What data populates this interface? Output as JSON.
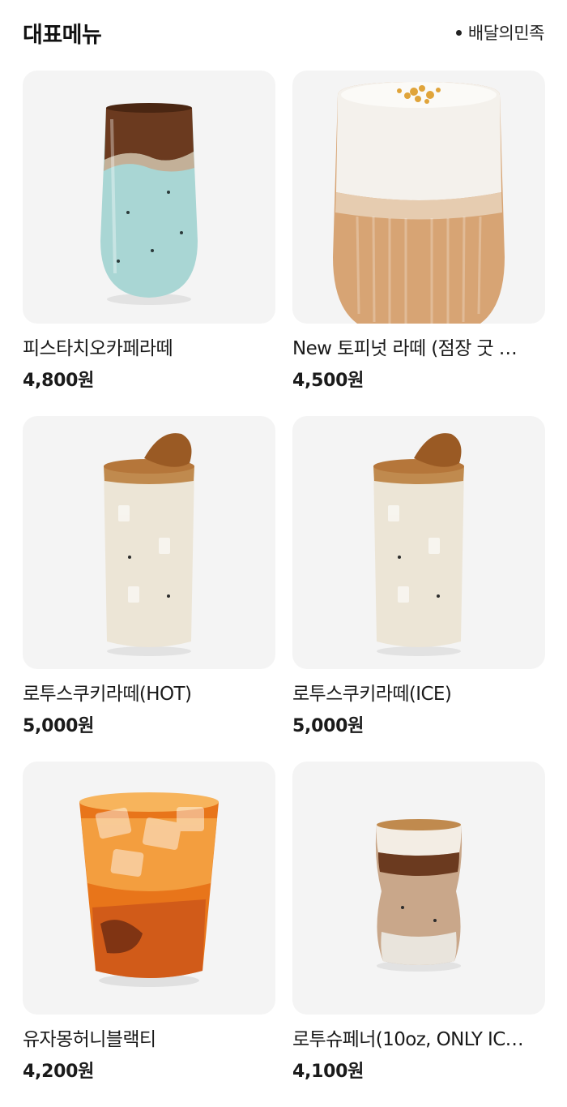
{
  "header": {
    "title": "대표메뉴",
    "source": "배달의민족"
  },
  "menu": [
    {
      "name": "피스타치오카페라떼",
      "price": "4,800원",
      "image": "pistachio-latte-glass"
    },
    {
      "name": "New 토피넛 라떼 (점장 굿 …",
      "price": "4,500원",
      "image": "toffee-nut-latte-glass"
    },
    {
      "name": "로투스쿠키라떼(HOT)",
      "price": "5,000원",
      "image": "lotus-cookie-latte-glass"
    },
    {
      "name": "로투스쿠키라떼(ICE)",
      "price": "5,000원",
      "image": "lotus-cookie-latte-glass"
    },
    {
      "name": "유자몽허니블랙티",
      "price": "4,200원",
      "image": "yuzu-grapefruit-tea-glass"
    },
    {
      "name": "로투슈페너(10oz, ONLY IC…",
      "price": "4,100원",
      "image": "lotus-einspanner-glass"
    }
  ],
  "colors": {
    "card_bg": "#f4f4f4",
    "pistachio": "#a9d6d4",
    "espresso": "#6b3a1f",
    "toffee": "#c8935e",
    "lotus_milk": "#ece5d6",
    "biscoff": "#b5763a",
    "tea": "#e8751a"
  }
}
